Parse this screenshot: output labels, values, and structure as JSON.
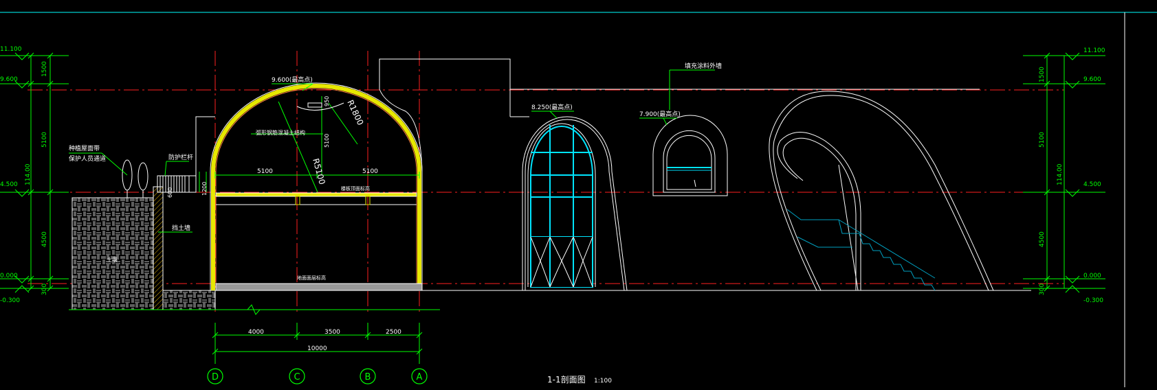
{
  "colors": {
    "background": "#000000",
    "line": "#ffffff",
    "axis": "#ff2020",
    "dimension": "#00ff00",
    "accent": "#00e5ff",
    "frame": "#00cccc",
    "arch_fill": "#e8e800",
    "hatch": "#cccccc"
  },
  "drawing": {
    "title": "1-1剖面图",
    "scale": "1:100"
  },
  "levels_left": [
    "11.100",
    "9.600",
    "4.500",
    "0.000",
    "-0.300"
  ],
  "levels_right": {
    "l1": "11.100",
    "l2": "9.600",
    "l3": "4.500",
    "l4": "0.000",
    "l5": "-0.300"
  },
  "vertical_dims": {
    "d1": "1500",
    "d2": "5100",
    "d3": "4500",
    "d4": "300",
    "total": "114.00"
  },
  "annotations": {
    "top_arch": "9.600(最高点)",
    "window_top": "8.250(最高点)",
    "small_window": "7.900(最高点)",
    "wall_material": "填充涂料外墙",
    "arc_label": "弧形钢筋混凝土结构",
    "radius_outer": "R1800",
    "radius_inner": "R5100",
    "arch_rise": "5100",
    "small_dim": "950",
    "span_left": "5100",
    "span_right": "5100",
    "guardrail": "防护栏杆",
    "rail_height": "1200",
    "rail_small": "600",
    "retaining_wall": "挡土墙",
    "planter": "种植屋面带",
    "planter2": "保护人员通道",
    "slab_label": "楼板顶面标高",
    "floor_label": "地面面层标高",
    "soil": "土壤"
  },
  "bottom_dims": {
    "d1": "4000",
    "d2": "3500",
    "d3": "2500",
    "total": "10000"
  },
  "axes": [
    "D",
    "C",
    "B",
    "A"
  ]
}
